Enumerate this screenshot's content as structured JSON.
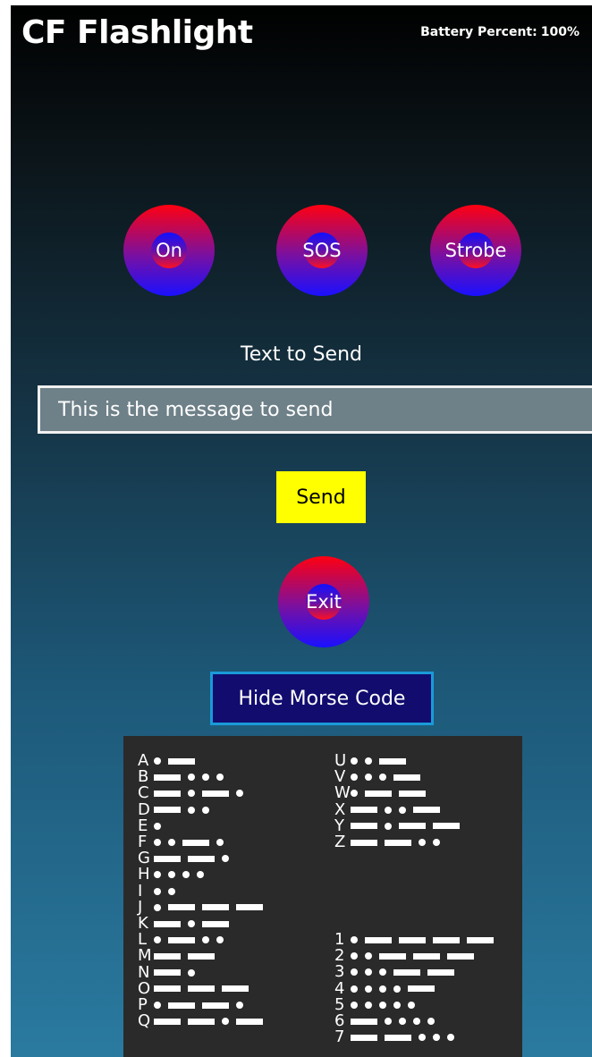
{
  "app": {
    "title": "CF Flashlight",
    "battery_label": "Battery Percent:",
    "battery_value": "100%"
  },
  "controls": {
    "on_label": "On",
    "sos_label": "SOS",
    "strobe_label": "Strobe",
    "exit_label": "Exit"
  },
  "message": {
    "label": "Text to Send",
    "value": "This is the message to send",
    "send_label": "Send"
  },
  "morse": {
    "toggle_label": "Hide Morse Code",
    "left_column": [
      {
        "char": "A",
        "code": ".-"
      },
      {
        "char": "B",
        "code": "-..."
      },
      {
        "char": "C",
        "code": "-.-."
      },
      {
        "char": "D",
        "code": "-.."
      },
      {
        "char": "E",
        "code": "."
      },
      {
        "char": "F",
        "code": "..-."
      },
      {
        "char": "G",
        "code": "--."
      },
      {
        "char": "H",
        "code": "...."
      },
      {
        "char": "I",
        "code": ".."
      },
      {
        "char": "J",
        "code": ".---"
      },
      {
        "char": "K",
        "code": "-.-"
      },
      {
        "char": "L",
        "code": ".-.."
      },
      {
        "char": "M",
        "code": "--"
      },
      {
        "char": "N",
        "code": "-."
      },
      {
        "char": "O",
        "code": "---"
      },
      {
        "char": "P",
        "code": ".--."
      },
      {
        "char": "Q",
        "code": "--.-"
      }
    ],
    "right_column_letters": [
      {
        "char": "U",
        "code": "..-"
      },
      {
        "char": "V",
        "code": "...-"
      },
      {
        "char": "W",
        "code": ".--"
      },
      {
        "char": "X",
        "code": "-..-"
      },
      {
        "char": "Y",
        "code": "-.--"
      },
      {
        "char": "Z",
        "code": "--.."
      }
    ],
    "right_column_numbers": [
      {
        "char": "1",
        "code": ".----"
      },
      {
        "char": "2",
        "code": "..---"
      },
      {
        "char": "3",
        "code": "...--"
      },
      {
        "char": "4",
        "code": "....-"
      },
      {
        "char": "5",
        "code": "....."
      },
      {
        "char": "6",
        "code": "-...."
      },
      {
        "char": "7",
        "code": "--..."
      }
    ]
  },
  "colors": {
    "send_button": "#ffff00",
    "hide_button_bg": "#110c6e",
    "hide_button_border": "#1a9ad8",
    "morse_panel_bg": "#2a2a2a",
    "input_bg": "#6e8088"
  }
}
